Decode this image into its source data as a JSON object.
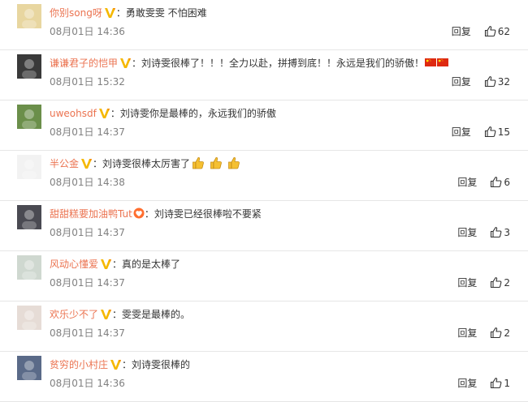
{
  "reply_label": "回复",
  "comments": [
    {
      "username": "你别song呀",
      "content": "勇敢雯雯 不怕困难",
      "time": "08月01日 14:36",
      "likes": "62",
      "badge": "vip",
      "avatar_color": "#e8d6a0"
    },
    {
      "username": "谦谦君子的恺甲",
      "content": "刘诗雯很棒了！！！全力以赴，拼搏到底！！永远是我们的骄傲！",
      "time": "08月01日 15:32",
      "likes": "32",
      "badge": "vip",
      "avatar_color": "#3a3a3a",
      "trailing": "flags"
    },
    {
      "username": "uweohsdf",
      "content": "刘诗雯你是最棒的，永远我们的骄傲",
      "time": "08月01日 14:37",
      "likes": "15",
      "badge": "vip",
      "avatar_color": "#6b8f4a"
    },
    {
      "username": "半公金",
      "content": "刘诗雯很棒太厉害了",
      "time": "08月01日 14:38",
      "likes": "6",
      "badge": "vip",
      "avatar_color": "#f2f2f2",
      "trailing": "thumbs"
    },
    {
      "username": "甜甜糕要加油鸭Tut",
      "content": "刘诗雯已经很棒啦不要紧",
      "time": "08月01日 14:37",
      "likes": "3",
      "badge": "heart",
      "avatar_color": "#4a4a52"
    },
    {
      "username": "风动心懂爱",
      "content": "真的是太棒了",
      "time": "08月01日 14:37",
      "likes": "2",
      "badge": "vip",
      "avatar_color": "#cfd8d0"
    },
    {
      "username": "欢乐少不了",
      "content": "雯雯是最棒的。",
      "time": "08月01日 14:37",
      "likes": "2",
      "badge": "vip",
      "avatar_color": "#e6dcd6"
    },
    {
      "username": "贫穷的小村庄",
      "content": "刘诗雯很棒的",
      "time": "08月01日 14:36",
      "likes": "1",
      "badge": "vip",
      "avatar_color": "#5a6a88"
    }
  ]
}
